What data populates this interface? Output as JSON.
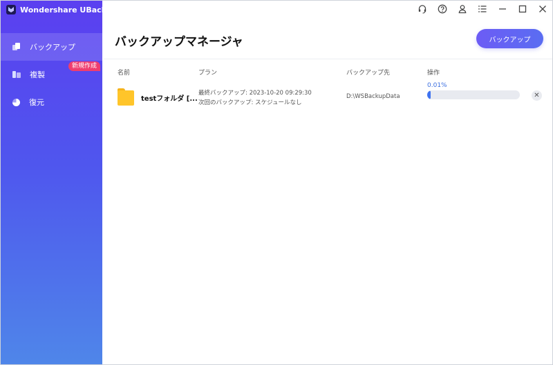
{
  "app": {
    "name": "Wondershare UBackit"
  },
  "sidebar": {
    "items": [
      {
        "label": "バックアップ",
        "icon": "backup-icon",
        "active": true
      },
      {
        "label": "複製",
        "icon": "clone-icon",
        "active": false
      },
      {
        "label": "復元",
        "icon": "restore-icon",
        "active": false
      }
    ],
    "badge": "新規作成"
  },
  "titlebar": {
    "icons": [
      "headset-icon",
      "help-icon",
      "account-icon",
      "menu-icon",
      "minimize-icon",
      "maximize-icon",
      "close-icon"
    ]
  },
  "main": {
    "title": "バックアップマネージャ",
    "primary_button": "バックアップ",
    "columns": {
      "name": "名前",
      "plan": "プラン",
      "destination": "バックアップ先",
      "action": "操作"
    },
    "rows": [
      {
        "name": "testフォルダ [...",
        "plan_last": "最終バックアップ: 2023-10-20 09:29:30",
        "plan_next": "次回のバックアップ: スケジュールなし",
        "destination": "D:\\WSBackupData",
        "progress_label": "0.01%",
        "progress_percent": 0.01
      }
    ]
  },
  "colors": {
    "sidebar_top": "#5b3ff0",
    "sidebar_bottom": "#4f86e9",
    "badge": "#ef3d6f",
    "progress": "#3f73f0",
    "folder": "#ffc52a"
  }
}
